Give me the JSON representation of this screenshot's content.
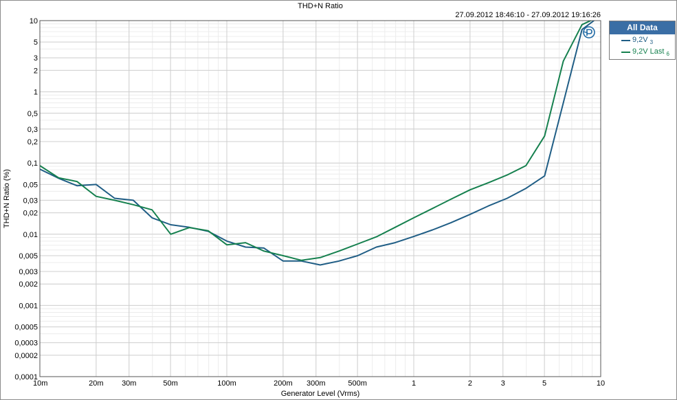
{
  "window": {
    "title": "THD+N Ratio",
    "time_range": "27.09.2012 18:46:10 -   27.09.2012 19:16:26"
  },
  "legend": {
    "header": "All Data",
    "items": [
      {
        "label": "9,2V",
        "sub": "3",
        "color": "#1f5d85"
      },
      {
        "label": "9,2V Last",
        "sub": "6",
        "color": "#15804e"
      }
    ]
  },
  "colors": {
    "grid_major": "#cfcfcf",
    "grid_minor": "#ececec",
    "legend_header_bg": "#3a6ea5"
  },
  "icons": {
    "logo": "ap-logo-icon"
  },
  "chart_data": {
    "type": "line",
    "title": "THD+N Ratio",
    "xlabel": "Generator Level (Vrms)",
    "ylabel": "THD+N Ratio (%)",
    "xscale": "log",
    "yscale": "log",
    "xlim": [
      0.01,
      10
    ],
    "ylim": [
      0.0001,
      10
    ],
    "grid": true,
    "legend_position": "top-right",
    "x_ticks": [
      {
        "v": 0.01,
        "label": "10m"
      },
      {
        "v": 0.02,
        "label": "20m"
      },
      {
        "v": 0.03,
        "label": "30m"
      },
      {
        "v": 0.05,
        "label": "50m"
      },
      {
        "v": 0.1,
        "label": "100m"
      },
      {
        "v": 0.2,
        "label": "200m"
      },
      {
        "v": 0.3,
        "label": "300m"
      },
      {
        "v": 0.5,
        "label": "500m"
      },
      {
        "v": 1,
        "label": "1"
      },
      {
        "v": 2,
        "label": "2"
      },
      {
        "v": 3,
        "label": "3"
      },
      {
        "v": 5,
        "label": "5"
      },
      {
        "v": 10,
        "label": "10"
      }
    ],
    "y_ticks": [
      {
        "v": 10,
        "label": "10"
      },
      {
        "v": 5,
        "label": "5"
      },
      {
        "v": 3,
        "label": "3"
      },
      {
        "v": 2,
        "label": "2"
      },
      {
        "v": 1,
        "label": "1"
      },
      {
        "v": 0.5,
        "label": "0,5"
      },
      {
        "v": 0.3,
        "label": "0,3"
      },
      {
        "v": 0.2,
        "label": "0,2"
      },
      {
        "v": 0.1,
        "label": "0,1"
      },
      {
        "v": 0.05,
        "label": "0,05"
      },
      {
        "v": 0.03,
        "label": "0,03"
      },
      {
        "v": 0.02,
        "label": "0,02"
      },
      {
        "v": 0.01,
        "label": "0,01"
      },
      {
        "v": 0.005,
        "label": "0,005"
      },
      {
        "v": 0.003,
        "label": "0,003"
      },
      {
        "v": 0.002,
        "label": "0,002"
      },
      {
        "v": 0.001,
        "label": "0,001"
      },
      {
        "v": 0.0005,
        "label": "0,0005"
      },
      {
        "v": 0.0003,
        "label": "0,0003"
      },
      {
        "v": 0.0002,
        "label": "0,0002"
      },
      {
        "v": 0.0001,
        "label": "0,0001"
      }
    ],
    "series": [
      {
        "name": "9,2V 3",
        "color": "#1f5d85",
        "points": [
          [
            0.01,
            0.082
          ],
          [
            0.0126,
            0.061
          ],
          [
            0.0158,
            0.048
          ],
          [
            0.02,
            0.05
          ],
          [
            0.0251,
            0.032
          ],
          [
            0.0316,
            0.03
          ],
          [
            0.0398,
            0.017
          ],
          [
            0.0501,
            0.0136
          ],
          [
            0.0631,
            0.0125
          ],
          [
            0.0794,
            0.011
          ],
          [
            0.1,
            0.008
          ],
          [
            0.126,
            0.0066
          ],
          [
            0.158,
            0.0064
          ],
          [
            0.2,
            0.0042
          ],
          [
            0.251,
            0.0042
          ],
          [
            0.316,
            0.0037
          ],
          [
            0.398,
            0.0042
          ],
          [
            0.501,
            0.005
          ],
          [
            0.631,
            0.0066
          ],
          [
            0.794,
            0.0076
          ],
          [
            1.0,
            0.0093
          ],
          [
            1.26,
            0.0115
          ],
          [
            1.58,
            0.0145
          ],
          [
            2.0,
            0.019
          ],
          [
            2.51,
            0.025
          ],
          [
            3.16,
            0.032
          ],
          [
            3.98,
            0.044
          ],
          [
            5.01,
            0.066
          ],
          [
            6.31,
            0.7
          ],
          [
            7.94,
            7.5
          ],
          [
            9.2,
            10.0
          ]
        ]
      },
      {
        "name": "9,2V Last 6",
        "color": "#15804e",
        "points": [
          [
            0.01,
            0.092
          ],
          [
            0.0126,
            0.062
          ],
          [
            0.0158,
            0.055
          ],
          [
            0.02,
            0.034
          ],
          [
            0.0251,
            0.03
          ],
          [
            0.0316,
            0.026
          ],
          [
            0.0398,
            0.022
          ],
          [
            0.0501,
            0.01
          ],
          [
            0.0631,
            0.0124
          ],
          [
            0.0794,
            0.0112
          ],
          [
            0.1,
            0.0071
          ],
          [
            0.126,
            0.0076
          ],
          [
            0.158,
            0.0058
          ],
          [
            0.2,
            0.005
          ],
          [
            0.251,
            0.0043
          ],
          [
            0.316,
            0.0047
          ],
          [
            0.398,
            0.0058
          ],
          [
            0.501,
            0.0073
          ],
          [
            0.631,
            0.0092
          ],
          [
            0.794,
            0.0125
          ],
          [
            1.0,
            0.017
          ],
          [
            1.26,
            0.023
          ],
          [
            1.58,
            0.031
          ],
          [
            2.0,
            0.042
          ],
          [
            2.51,
            0.053
          ],
          [
            3.16,
            0.068
          ],
          [
            3.98,
            0.092
          ],
          [
            5.01,
            0.24
          ],
          [
            6.31,
            2.7
          ],
          [
            7.94,
            8.8
          ],
          [
            9.2,
            10.5
          ]
        ]
      }
    ]
  }
}
